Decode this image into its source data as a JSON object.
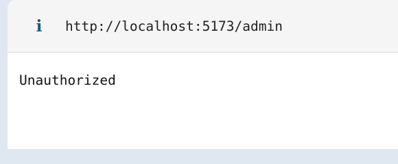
{
  "address_bar": {
    "icon": "info-icon",
    "url": "http://localhost:5173/admin"
  },
  "page": {
    "message": "Unauthorized"
  },
  "colors": {
    "background": "#dfe7f1",
    "address_bar": "#f5f5f6",
    "icon": "#1d5d71",
    "text": "#111111"
  }
}
